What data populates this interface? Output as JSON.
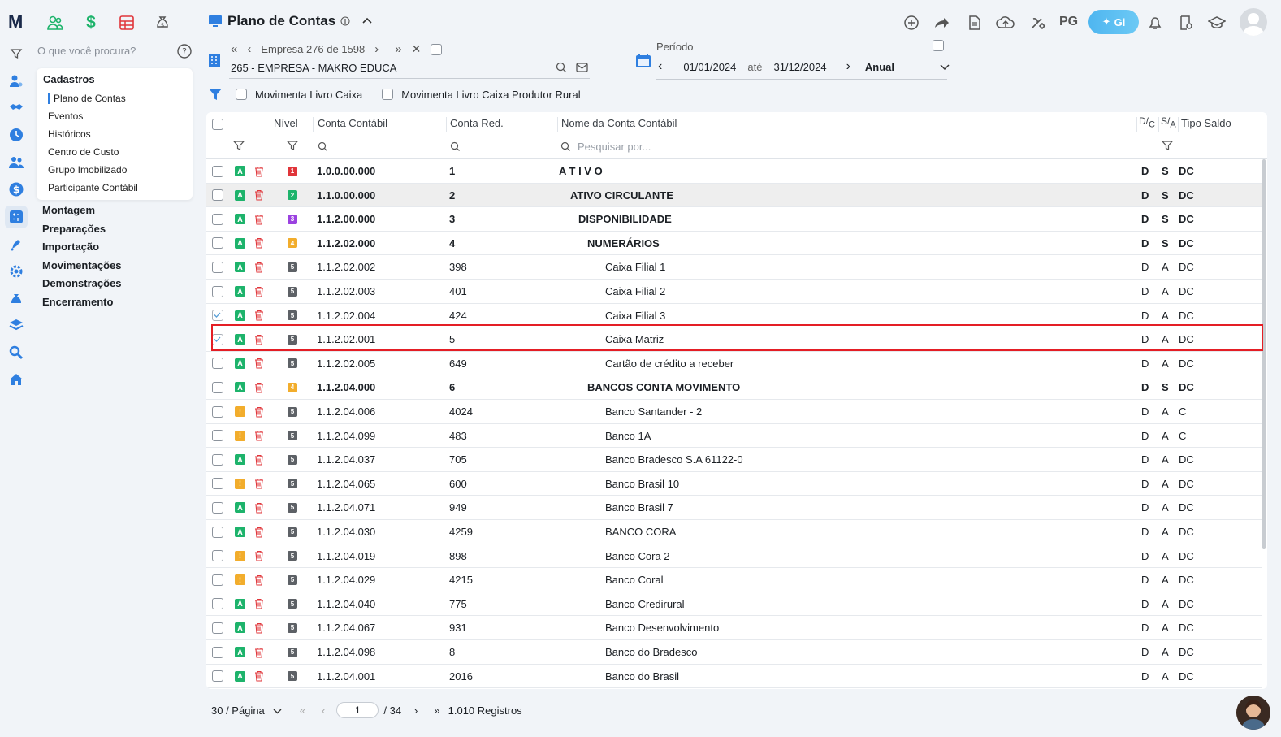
{
  "app": {
    "brand": "M",
    "title": "Plano de Contas",
    "pg_label": "PG",
    "gi_label": "Gi"
  },
  "search": {
    "placeholder": "O que você procura?"
  },
  "menu": {
    "section": "Cadastros",
    "sub_items": [
      "Plano de Contas",
      "Eventos",
      "Históricos",
      "Centro de Custo",
      "Grupo Imobilizado",
      "Participante Contábil"
    ],
    "main_items": [
      "Montagem",
      "Preparações",
      "Importação",
      "Movimentações",
      "Demonstrações",
      "Encerramento"
    ]
  },
  "empresa": {
    "nav_label": "Empresa 276 de 1598",
    "name": "265 - EMPRESA - MAKRO EDUCA"
  },
  "periodo": {
    "label": "Período",
    "start": "01/01/2024",
    "sep": "até",
    "end": "31/12/2024",
    "mode": "Anual"
  },
  "filters": {
    "f1": "Movimenta Livro Caixa",
    "f2": "Movimenta Livro Caixa Produtor Rural"
  },
  "table": {
    "headers": {
      "nivel": "Nível",
      "conta": "Conta Contábil",
      "red": "Conta Red.",
      "nome": "Nome da Conta Contábil",
      "dc_top": "D",
      "dc_bot": "C",
      "sa_top": "S",
      "sa_bot": "A",
      "tipo": "Tipo Saldo"
    },
    "search_placeholder": "Pesquisar por...",
    "rows": [
      {
        "status": "A",
        "level": "1",
        "conta": "1.0.0.00.000",
        "red": "1",
        "nome": "A T I V O",
        "dc": "D",
        "sa": "S",
        "tipo": "DC",
        "bold": true,
        "indent": 0,
        "checked": false,
        "shaded": false
      },
      {
        "status": "A",
        "level": "2",
        "conta": "1.1.0.00.000",
        "red": "2",
        "nome": "ATIVO CIRCULANTE",
        "dc": "D",
        "sa": "S",
        "tipo": "DC",
        "bold": true,
        "indent": 1,
        "checked": false,
        "shaded": true
      },
      {
        "status": "A",
        "level": "3",
        "conta": "1.1.2.00.000",
        "red": "3",
        "nome": "DISPONIBILIDADE",
        "dc": "D",
        "sa": "S",
        "tipo": "DC",
        "bold": true,
        "indent": 2,
        "checked": false,
        "shaded": false
      },
      {
        "status": "A",
        "level": "4",
        "conta": "1.1.2.02.000",
        "red": "4",
        "nome": "NUMERÁRIOS",
        "dc": "D",
        "sa": "S",
        "tipo": "DC",
        "bold": true,
        "indent": 3,
        "checked": false,
        "shaded": false
      },
      {
        "status": "A",
        "level": "5",
        "conta": "1.1.2.02.002",
        "red": "398",
        "nome": "Caixa Filial 1",
        "dc": "D",
        "sa": "A",
        "tipo": "DC",
        "bold": false,
        "indent": 4,
        "checked": false,
        "shaded": false
      },
      {
        "status": "A",
        "level": "5",
        "conta": "1.1.2.02.003",
        "red": "401",
        "nome": "Caixa Filial 2",
        "dc": "D",
        "sa": "A",
        "tipo": "DC",
        "bold": false,
        "indent": 4,
        "checked": false,
        "shaded": false
      },
      {
        "status": "A",
        "level": "5",
        "conta": "1.1.2.02.004",
        "red": "424",
        "nome": "Caixa Filial 3",
        "dc": "D",
        "sa": "A",
        "tipo": "DC",
        "bold": false,
        "indent": 4,
        "checked": true,
        "shaded": false
      },
      {
        "status": "A",
        "level": "5",
        "conta": "1.1.2.02.001",
        "red": "5",
        "nome": "Caixa Matriz",
        "dc": "D",
        "sa": "A",
        "tipo": "DC",
        "bold": false,
        "indent": 4,
        "checked": true,
        "shaded": false
      },
      {
        "status": "A",
        "level": "5",
        "conta": "1.1.2.02.005",
        "red": "649",
        "nome": "Cartão de crédito a receber",
        "dc": "D",
        "sa": "A",
        "tipo": "DC",
        "bold": false,
        "indent": 4,
        "checked": false,
        "shaded": false
      },
      {
        "status": "A",
        "level": "4",
        "conta": "1.1.2.04.000",
        "red": "6",
        "nome": "BANCOS CONTA MOVIMENTO",
        "dc": "D",
        "sa": "S",
        "tipo": "DC",
        "bold": true,
        "indent": 3,
        "checked": false,
        "shaded": false
      },
      {
        "status": "!",
        "level": "5",
        "conta": "1.1.2.04.006",
        "red": "4024",
        "nome": "Banco Santander - 2",
        "dc": "D",
        "sa": "A",
        "tipo": "C",
        "bold": false,
        "indent": 4,
        "checked": false,
        "shaded": false
      },
      {
        "status": "!",
        "level": "5",
        "conta": "1.1.2.04.099",
        "red": "483",
        "nome": "Banco 1A",
        "dc": "D",
        "sa": "A",
        "tipo": "C",
        "bold": false,
        "indent": 4,
        "checked": false,
        "shaded": false
      },
      {
        "status": "A",
        "level": "5",
        "conta": "1.1.2.04.037",
        "red": "705",
        "nome": "Banco Bradesco S.A 61122-0",
        "dc": "D",
        "sa": "A",
        "tipo": "DC",
        "bold": false,
        "indent": 4,
        "checked": false,
        "shaded": false
      },
      {
        "status": "!",
        "level": "5",
        "conta": "1.1.2.04.065",
        "red": "600",
        "nome": "Banco Brasil 10",
        "dc": "D",
        "sa": "A",
        "tipo": "DC",
        "bold": false,
        "indent": 4,
        "checked": false,
        "shaded": false
      },
      {
        "status": "A",
        "level": "5",
        "conta": "1.1.2.04.071",
        "red": "949",
        "nome": "Banco Brasil 7",
        "dc": "D",
        "sa": "A",
        "tipo": "DC",
        "bold": false,
        "indent": 4,
        "checked": false,
        "shaded": false
      },
      {
        "status": "A",
        "level": "5",
        "conta": "1.1.2.04.030",
        "red": "4259",
        "nome": "BANCO CORA",
        "dc": "D",
        "sa": "A",
        "tipo": "DC",
        "bold": false,
        "indent": 4,
        "checked": false,
        "shaded": false
      },
      {
        "status": "!",
        "level": "5",
        "conta": "1.1.2.04.019",
        "red": "898",
        "nome": "Banco Cora 2",
        "dc": "D",
        "sa": "A",
        "tipo": "DC",
        "bold": false,
        "indent": 4,
        "checked": false,
        "shaded": false
      },
      {
        "status": "!",
        "level": "5",
        "conta": "1.1.2.04.029",
        "red": "4215",
        "nome": "Banco Coral",
        "dc": "D",
        "sa": "A",
        "tipo": "DC",
        "bold": false,
        "indent": 4,
        "checked": false,
        "shaded": false
      },
      {
        "status": "A",
        "level": "5",
        "conta": "1.1.2.04.040",
        "red": "775",
        "nome": "Banco Credirural",
        "dc": "D",
        "sa": "A",
        "tipo": "DC",
        "bold": false,
        "indent": 4,
        "checked": false,
        "shaded": false
      },
      {
        "status": "A",
        "level": "5",
        "conta": "1.1.2.04.067",
        "red": "931",
        "nome": "Banco Desenvolvimento",
        "dc": "D",
        "sa": "A",
        "tipo": "DC",
        "bold": false,
        "indent": 4,
        "checked": false,
        "shaded": false
      },
      {
        "status": "A",
        "level": "5",
        "conta": "1.1.2.04.098",
        "red": "8",
        "nome": "Banco do Bradesco",
        "dc": "D",
        "sa": "A",
        "tipo": "DC",
        "bold": false,
        "indent": 4,
        "checked": false,
        "shaded": false
      },
      {
        "status": "A",
        "level": "5",
        "conta": "1.1.2.04.001",
        "red": "2016",
        "nome": "Banco do Brasil",
        "dc": "D",
        "sa": "A",
        "tipo": "DC",
        "bold": false,
        "indent": 4,
        "checked": false,
        "shaded": false
      }
    ]
  },
  "pagination": {
    "per_page": "30 / Página",
    "current": "1",
    "total": "/ 34",
    "records": "1.010 Registros"
  },
  "colors": {
    "green": "#1db36b",
    "orange": "#f2ad2c",
    "red": "#e0353a",
    "purple": "#9b42e0",
    "gray": "#5d6166",
    "accent": "#2f7fe0"
  }
}
